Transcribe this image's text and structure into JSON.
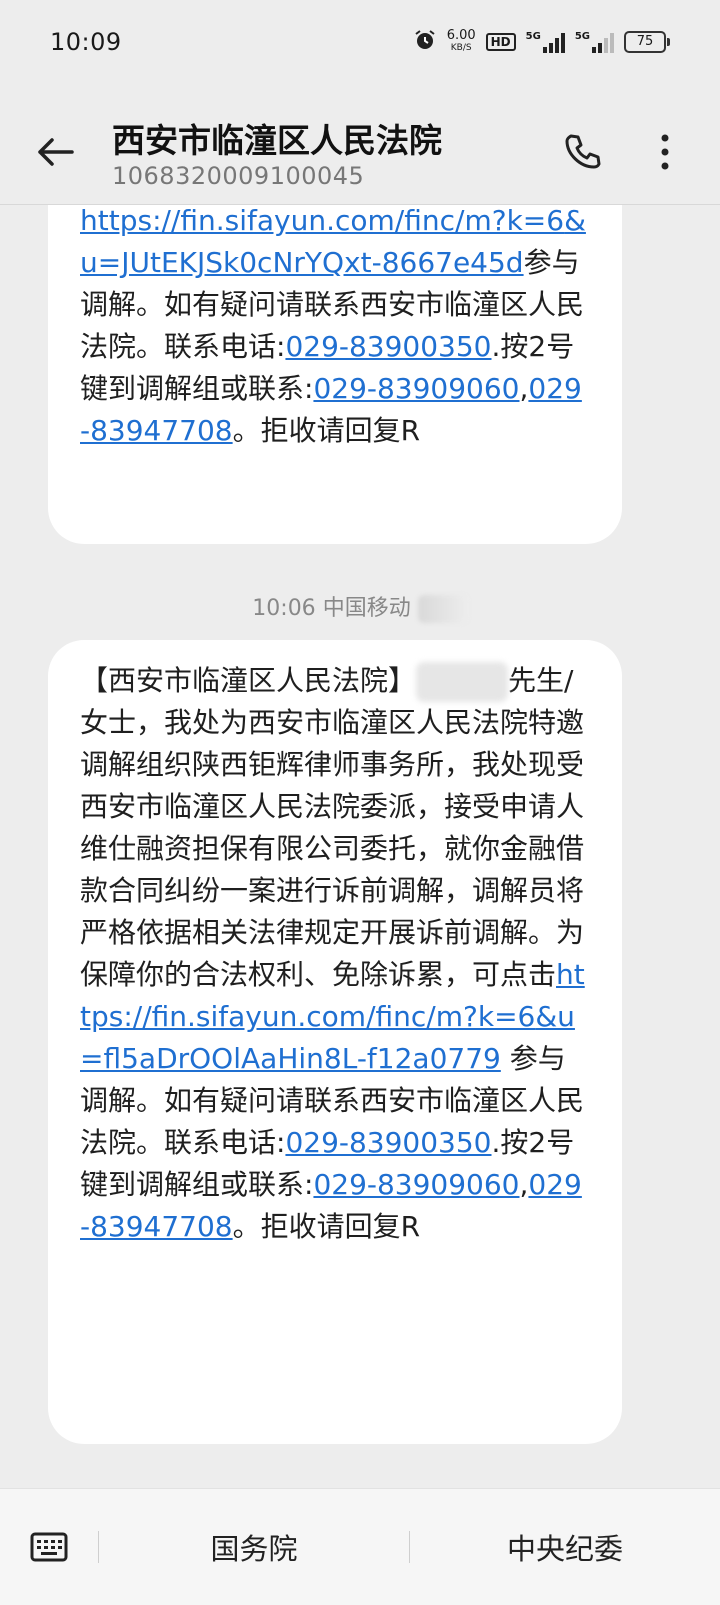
{
  "status_bar": {
    "time": "10:09",
    "net_speed_value": "6.00",
    "net_speed_unit": "KB/S",
    "hd_label": "HD",
    "signal1_label": "5G",
    "signal2_label": "5G",
    "battery": "75",
    "icons": [
      "alarm-icon",
      "hd-icon",
      "signal-icon",
      "battery-icon"
    ]
  },
  "header": {
    "contact_name": "西安市临潼区人民法院",
    "contact_number": "1068320009100045"
  },
  "messages": [
    {
      "link_part1": "https://fin.sifayun.com/finc/m?k=6",
      "link_part2": "&u=JUtEKJSk0cNrYQxt-8667e45d",
      "text_after_link": "参与调解。如有疑问请联系西安市临潼区人民法院。联系电话:",
      "phone_main": "029-83900350",
      "text_mid": ".按2号键到调解组或联系:",
      "phone_alt1": "029-83909060",
      "comma": ",",
      "phone_alt2": "029-83947708",
      "text_end": "。拒收请回复R"
    },
    {
      "time": "10:06",
      "carrier": "中国移动",
      "text_before_link": "【西安市临潼区人民法院】",
      "text_body": "先生/女士，我处为西安市临潼区人民法院特邀调解组织陕西钜辉律师事务所，我处现受西安市临潼区人民法院委派，接受申请人维仕融资担保有限公司委托，就你金融借款合同纠纷一案进行诉前调解，调解员将严格依据相关法律规定开展诉前调解。为保障你的合法权利、免除诉累，可点击",
      "link_part1": "https://fin.sifayun.com/finc/m?k=6",
      "link_part2": "&u=fl5aDrOOlAaHin8L-f12a0779",
      "text_after_link": " 参与调解。如有疑问请联系西安市临潼区人民法院。联系电话:",
      "phone_main": "029-83900350",
      "text_mid": ".按2号键到调解组或联系:",
      "phone_alt1": "029-83909060",
      "comma": ",",
      "phone_alt2": "029-83947708",
      "text_end": "。拒收请回复R"
    }
  ],
  "bottom_bar": {
    "quick_reply_1": "国务院",
    "quick_reply_2": "中央纪委"
  },
  "colors": {
    "background": "#ededed",
    "bubble": "#ffffff",
    "link": "#1f6fd1"
  }
}
